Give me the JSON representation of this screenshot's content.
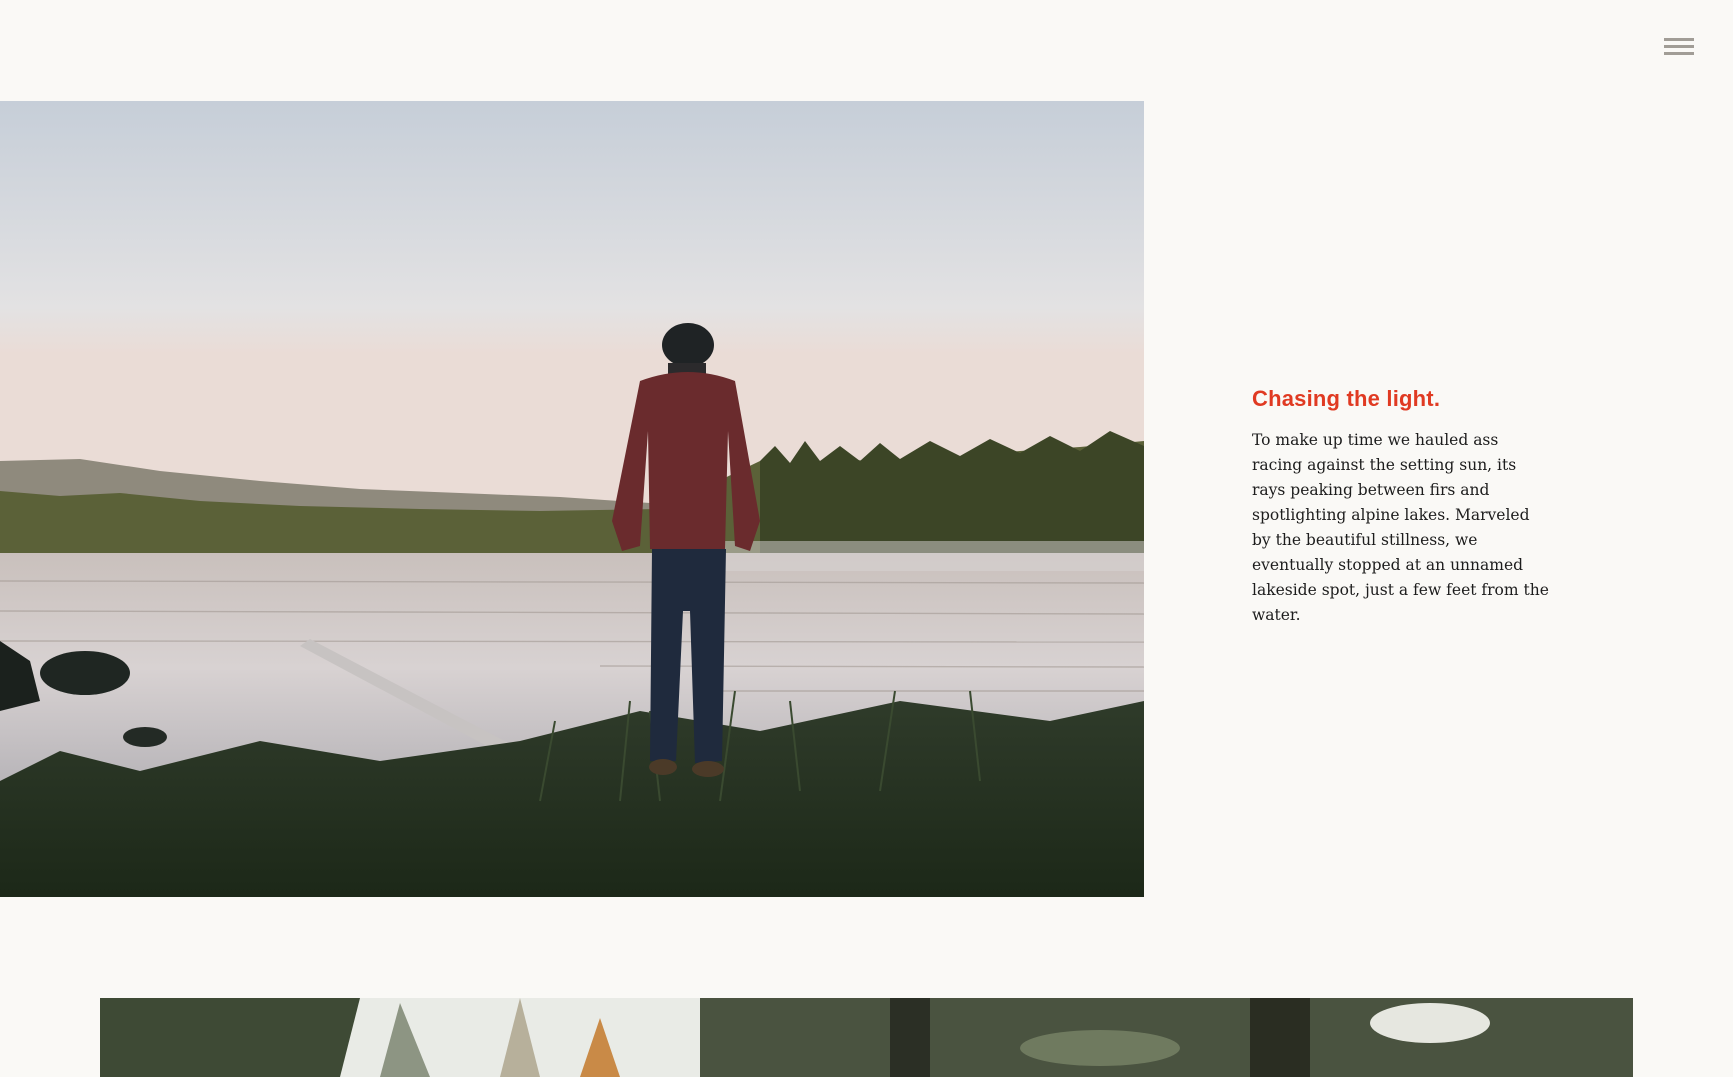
{
  "header": {
    "menu_icon": "hamburger-menu-icon",
    "menu_color": "#a19d96"
  },
  "story": {
    "title": "Chasing the light.",
    "body": "To make up time we hauled ass racing against the setting sun, its rays peaking between firs and spotlighting alpine lakes. Marveled by the beautiful stillness, we eventually stopped at an unnamed lakeside spot, just a few feet from the water.",
    "accent_color": "#e03a22"
  },
  "photos": {
    "hero": "lake-photo",
    "next": "forest-photo"
  }
}
